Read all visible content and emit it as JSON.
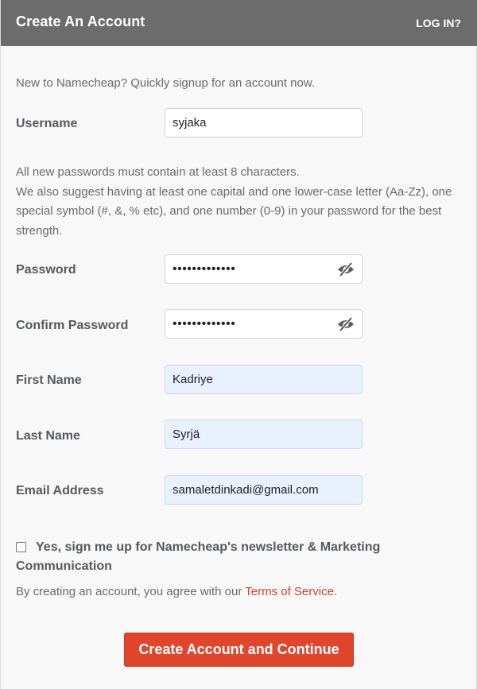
{
  "header": {
    "title": "Create An Account",
    "login_link": "LOG IN?"
  },
  "intro": "New to Namecheap? Quickly signup for an account now.",
  "username": {
    "label": "Username",
    "value": "syjaka"
  },
  "password_hint": {
    "line1": "All new passwords must contain at least 8 characters.",
    "line2": "We also suggest having at least one capital and one lower-case letter (Aa-Zz), one special symbol (#, &, % etc), and one number (0-9) in your password for the best strength."
  },
  "password": {
    "label": "Password",
    "value": "•••••••••••••",
    "toggle_icon": "eye-slash-icon"
  },
  "confirm_password": {
    "label": "Confirm Password",
    "value": "•••••••••••••",
    "toggle_icon": "eye-slash-icon"
  },
  "first_name": {
    "label": "First Name",
    "value": "Kadriye"
  },
  "last_name": {
    "label": "Last Name",
    "value": "Syrjä"
  },
  "email": {
    "label": "Email Address",
    "value": "samaletdinkadi@gmail.com"
  },
  "newsletter": {
    "label": "Yes, sign me up for Namecheap's newsletter & Marketing Communication",
    "checked": false
  },
  "terms": {
    "prefix": "By creating an account, you agree with our ",
    "link": "Terms of Service",
    "suffix": "."
  },
  "submit": {
    "label": "Create Account and Continue"
  },
  "colors": {
    "header_bg": "#6c6c6c",
    "accent": "#e1452b",
    "autofill_bg": "#e9f0fe"
  }
}
